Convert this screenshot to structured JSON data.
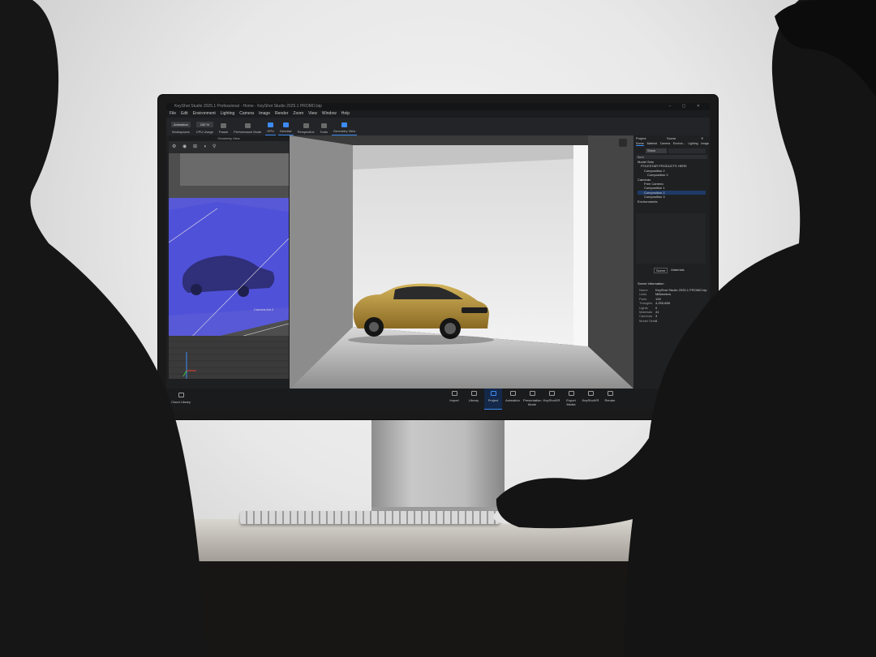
{
  "app": {
    "title": "KeyShot Studio 2025.1 Professional - Home - KeyShot Studio 2025.1 PROMO.bip",
    "menu": [
      "File",
      "Edit",
      "Environment",
      "Lighting",
      "Camera",
      "Image",
      "Render",
      "Zoom",
      "View",
      "Window",
      "Help"
    ],
    "toolbar": [
      {
        "label": "Workspaces",
        "active": false
      },
      {
        "label": "CPU Usage",
        "active": false
      },
      {
        "label": "Pause",
        "active": false
      },
      {
        "label": "Performance Mode",
        "active": false
      },
      {
        "label": "GPU",
        "active": true
      },
      {
        "label": "Denoise",
        "active": true
      },
      {
        "label": "Perspective",
        "active": false
      },
      {
        "label": "Tools",
        "active": false
      },
      {
        "label": "Geometry View",
        "active": true
      }
    ],
    "workspace_select": "Animation",
    "zoom_value": "100 %"
  },
  "geometry_view": {
    "title": "Geometry View",
    "camera_label": "Camera Ani 2"
  },
  "project_panel": {
    "title": "Project",
    "scene_title": "Scene",
    "tabs": [
      "Scene",
      "Material",
      "Camera",
      "Environ...",
      "Lighting",
      "Image"
    ],
    "show_label": "Show",
    "column_header": "Item",
    "tree": [
      "Model Sets",
      "POLESTAR PRODUCTS HERE",
      "Composition 2",
      "Composition 2",
      "Cameras",
      "Free Camera",
      "Composition 1",
      "Composition 2",
      "Composition 3",
      "Environments"
    ],
    "subtabs": [
      "Scene",
      "Materials"
    ],
    "info_header": "Scene Information",
    "info": [
      {
        "k": "Name",
        "v": "KeyShot Studio 2025.1 PROMO.bip"
      },
      {
        "k": "Units",
        "v": "Millimeters"
      },
      {
        "k": "Parts",
        "v": "126"
      },
      {
        "k": "Triangles",
        "v": "4,255,688"
      },
      {
        "k": "Lights",
        "v": "0"
      },
      {
        "k": "Materials",
        "v": "41"
      },
      {
        "k": "Cameras",
        "v": "3"
      },
      {
        "k": "Model Sets",
        "v": "6"
      }
    ]
  },
  "bottom_bar": {
    "left": "Cloud Library",
    "items": [
      {
        "label": "Import",
        "active": false
      },
      {
        "label": "Library",
        "active": false
      },
      {
        "label": "Project",
        "active": true
      },
      {
        "label": "Animation",
        "active": false
      },
      {
        "label": "Presentation Mode",
        "active": false
      },
      {
        "label": "KeyShotXR",
        "active": false
      },
      {
        "label": "Export Media",
        "active": false
      },
      {
        "label": "KeyShotVR",
        "active": false
      },
      {
        "label": "Render",
        "active": false
      }
    ]
  },
  "colors": {
    "accent": "#3d8bf2",
    "car": "#b8963a",
    "geo_highlight": "#5a5cf0"
  }
}
